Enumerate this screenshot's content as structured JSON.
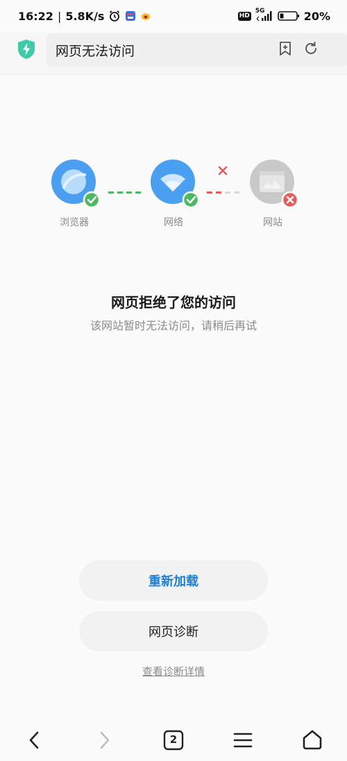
{
  "status_bar": {
    "time": "16:22",
    "separator": "|",
    "speed": "5.8K/s",
    "network_type": "5G",
    "hd_label": "HD",
    "battery": "20%",
    "icons": [
      "alarm-icon",
      "app-notification-icon",
      "weibo-icon",
      "hd-icon",
      "signal-icon",
      "battery-icon"
    ]
  },
  "address_bar": {
    "title": "网页无法访问",
    "icons": [
      "shield-icon",
      "add-bookmark-icon",
      "refresh-icon"
    ],
    "accent_color": "#3ec9a7"
  },
  "diagnostic": {
    "nodes": [
      {
        "label": "浏览器",
        "status": "ok",
        "icon": "browser-icon"
      },
      {
        "label": "网络",
        "status": "ok",
        "icon": "wifi-icon"
      },
      {
        "label": "网站",
        "status": "error",
        "icon": "website-icon"
      }
    ],
    "colors": {
      "ok": "#4cb861",
      "error": "#e35d5d",
      "node_blue": "#4a9ff0",
      "node_gray": "#c9c9c9"
    }
  },
  "message": {
    "title": "网页拒绝了您的访问",
    "subtitle": "该网站暂时无法访问，请稍后再试"
  },
  "actions": {
    "reload_label": "重新加载",
    "diagnose_label": "网页诊断",
    "details_link": "查看诊断详情"
  },
  "bottom_nav": {
    "tab_count": "2",
    "icons": [
      "back-icon",
      "forward-icon",
      "tabs-icon",
      "menu-icon",
      "home-icon"
    ]
  }
}
